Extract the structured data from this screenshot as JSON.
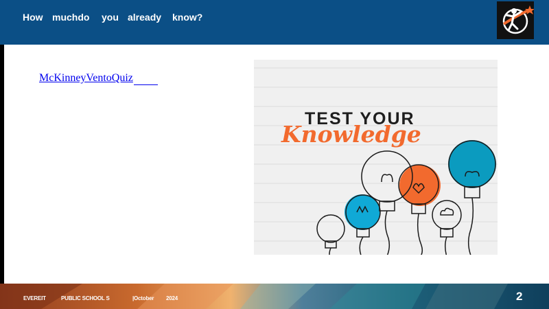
{
  "header": {
    "title_words": [
      "How",
      "muchdo",
      "you",
      "already",
      "know?"
    ],
    "background": "#0b4f86",
    "logo_icon": "everett-logo-icon"
  },
  "main": {
    "link_label": "McKinneyVentoQuiz",
    "link_color": "#0000ee"
  },
  "image": {
    "line1": "TEST YOUR",
    "line2": "Knowledge",
    "accent_orange": "#f26a2e",
    "accent_blue": "#10a9d6",
    "accent_teal": "#0b9bbf"
  },
  "footer": {
    "org1": "EVEREIT",
    "org2": "PUBLIC SCHOOL S",
    "month": "|October",
    "year": "2024",
    "page_number": "2"
  }
}
